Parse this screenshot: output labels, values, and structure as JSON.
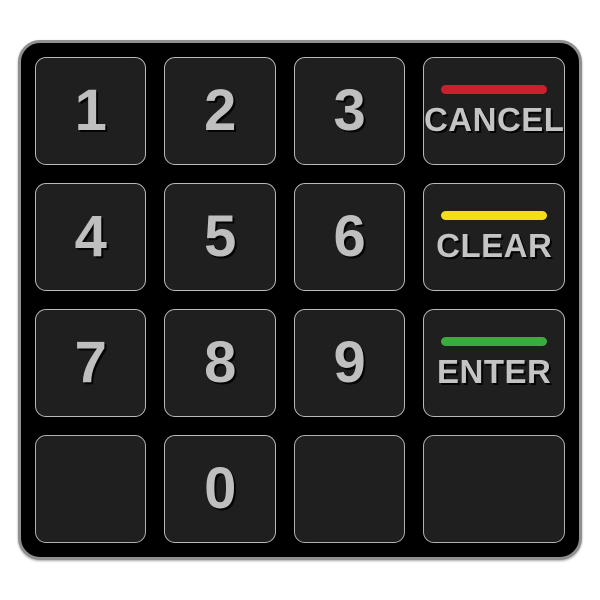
{
  "device": {
    "name": "numeric-keypad",
    "frame_color": "#8f8f8f",
    "body_color": "#000000",
    "key_face_color": "#1f1f1f",
    "key_border_color": "#b9b9b9",
    "label_color": "#bfbfbf"
  },
  "keys": [
    {
      "id": "key-1",
      "type": "digit",
      "label": "1",
      "row": 1,
      "col": 1
    },
    {
      "id": "key-2",
      "type": "digit",
      "label": "2",
      "row": 1,
      "col": 2
    },
    {
      "id": "key-3",
      "type": "digit",
      "label": "3",
      "row": 1,
      "col": 3
    },
    {
      "id": "key-cancel",
      "type": "function",
      "label": "CANCEL",
      "row": 1,
      "col": 4,
      "bar_color": "#cc1f2e"
    },
    {
      "id": "key-4",
      "type": "digit",
      "label": "4",
      "row": 2,
      "col": 1
    },
    {
      "id": "key-5",
      "type": "digit",
      "label": "5",
      "row": 2,
      "col": 2
    },
    {
      "id": "key-6",
      "type": "digit",
      "label": "6",
      "row": 2,
      "col": 3
    },
    {
      "id": "key-clear",
      "type": "function",
      "label": "CLEAR",
      "row": 2,
      "col": 4,
      "bar_color": "#f5dd1b"
    },
    {
      "id": "key-7",
      "type": "digit",
      "label": "7",
      "row": 3,
      "col": 1
    },
    {
      "id": "key-8",
      "type": "digit",
      "label": "8",
      "row": 3,
      "col": 2
    },
    {
      "id": "key-9",
      "type": "digit",
      "label": "9",
      "row": 3,
      "col": 3
    },
    {
      "id": "key-enter",
      "type": "function",
      "label": "ENTER",
      "row": 3,
      "col": 4,
      "bar_color": "#3aab3d"
    },
    {
      "id": "key-blank-1",
      "type": "blank",
      "label": "",
      "row": 4,
      "col": 1
    },
    {
      "id": "key-0",
      "type": "digit",
      "label": "0",
      "row": 4,
      "col": 2
    },
    {
      "id": "key-blank-2",
      "type": "blank",
      "label": "",
      "row": 4,
      "col": 3
    },
    {
      "id": "key-blank-3",
      "type": "blank",
      "label": "",
      "row": 4,
      "col": 4
    }
  ]
}
